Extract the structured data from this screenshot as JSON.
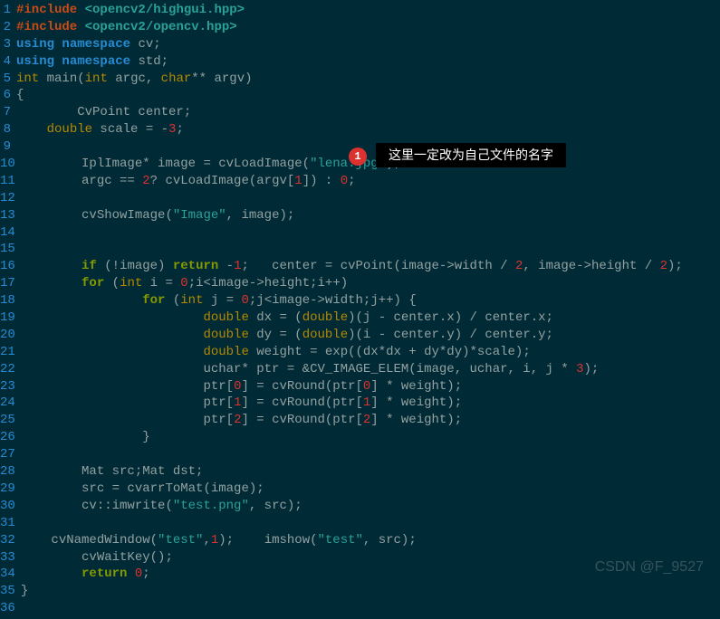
{
  "annotation": {
    "badge": "1",
    "text": "这里一定改为自己文件的名字"
  },
  "watermark": "CSDN @F_9527",
  "lines": [
    {
      "n": 1,
      "tokens": [
        [
          "preproc",
          "#include "
        ],
        [
          "incpath",
          "<opencv2/highgui.hpp>"
        ]
      ]
    },
    {
      "n": 2,
      "tokens": [
        [
          "preproc",
          "#include "
        ],
        [
          "incpath",
          "<opencv2/opencv.hpp>"
        ]
      ]
    },
    {
      "n": 3,
      "tokens": [
        [
          "kwblue",
          "using"
        ],
        [
          "ident",
          " "
        ],
        [
          "kwblue",
          "namespace"
        ],
        [
          "ident",
          " cv;"
        ]
      ]
    },
    {
      "n": 4,
      "tokens": [
        [
          "kwblue",
          "using"
        ],
        [
          "ident",
          " "
        ],
        [
          "kwblue",
          "namespace"
        ],
        [
          "ident",
          " std;"
        ]
      ]
    },
    {
      "n": 5,
      "tokens": [
        [
          "type",
          "int"
        ],
        [
          "ident",
          " main("
        ],
        [
          "type",
          "int"
        ],
        [
          "ident",
          " argc, "
        ],
        [
          "type",
          "char"
        ],
        [
          "ident",
          "** argv)"
        ]
      ]
    },
    {
      "n": 6,
      "tokens": [
        [
          "punc",
          "{"
        ]
      ]
    },
    {
      "n": 7,
      "tokens": [
        [
          "ident",
          "        CvPoint center;"
        ]
      ]
    },
    {
      "n": 8,
      "tokens": [
        [
          "ident",
          "    "
        ],
        [
          "type",
          "double"
        ],
        [
          "ident",
          " scale = -"
        ],
        [
          "num",
          "3"
        ],
        [
          "ident",
          ";"
        ]
      ]
    },
    {
      "n": 9,
      "tokens": [
        [
          "ident",
          " "
        ]
      ]
    },
    {
      "n": 10,
      "tokens": [
        [
          "ident",
          "        IplImage* image = cvLoadImage("
        ],
        [
          "str",
          "\"lena.jpg\""
        ],
        [
          "ident",
          ");"
        ]
      ]
    },
    {
      "n": 11,
      "tokens": [
        [
          "ident",
          "        argc == "
        ],
        [
          "num",
          "2"
        ],
        [
          "ident",
          "? cvLoadImage(argv["
        ],
        [
          "num",
          "1"
        ],
        [
          "ident",
          "]) : "
        ],
        [
          "num",
          "0"
        ],
        [
          "ident",
          ";"
        ]
      ]
    },
    {
      "n": 12,
      "tokens": [
        [
          "ident",
          " "
        ]
      ]
    },
    {
      "n": 13,
      "tokens": [
        [
          "ident",
          "        cvShowImage("
        ],
        [
          "str",
          "\"Image\""
        ],
        [
          "ident",
          ", image);"
        ]
      ]
    },
    {
      "n": 14,
      "tokens": [
        [
          "ident",
          " "
        ]
      ]
    },
    {
      "n": 15,
      "tokens": [
        [
          "ident",
          " "
        ]
      ]
    },
    {
      "n": 16,
      "tokens": [
        [
          "ident",
          "        "
        ],
        [
          "kw",
          "if"
        ],
        [
          "ident",
          " (!image) "
        ],
        [
          "kw",
          "return"
        ],
        [
          "ident",
          " -"
        ],
        [
          "num",
          "1"
        ],
        [
          "ident",
          ";   center = cvPoint(image->width / "
        ],
        [
          "num",
          "2"
        ],
        [
          "ident",
          ", image->height / "
        ],
        [
          "num",
          "2"
        ],
        [
          "ident",
          ");"
        ]
      ]
    },
    {
      "n": 17,
      "tokens": [
        [
          "ident",
          "        "
        ],
        [
          "kw",
          "for"
        ],
        [
          "ident",
          " ("
        ],
        [
          "type",
          "int"
        ],
        [
          "ident",
          " i = "
        ],
        [
          "num",
          "0"
        ],
        [
          "ident",
          ";i<image->height;i++)"
        ]
      ]
    },
    {
      "n": 18,
      "tokens": [
        [
          "ident",
          "                "
        ],
        [
          "kw",
          "for"
        ],
        [
          "ident",
          " ("
        ],
        [
          "type",
          "int"
        ],
        [
          "ident",
          " j = "
        ],
        [
          "num",
          "0"
        ],
        [
          "ident",
          ";j<image->width;j++) {"
        ]
      ]
    },
    {
      "n": 19,
      "tokens": [
        [
          "ident",
          "                        "
        ],
        [
          "type",
          "double"
        ],
        [
          "ident",
          " dx = ("
        ],
        [
          "type",
          "double"
        ],
        [
          "ident",
          ")(j - center.x) / center.x;"
        ]
      ]
    },
    {
      "n": 20,
      "tokens": [
        [
          "ident",
          "                        "
        ],
        [
          "type",
          "double"
        ],
        [
          "ident",
          " dy = ("
        ],
        [
          "type",
          "double"
        ],
        [
          "ident",
          ")(i - center.y) / center.y;"
        ]
      ]
    },
    {
      "n": 21,
      "tokens": [
        [
          "ident",
          "                        "
        ],
        [
          "type",
          "double"
        ],
        [
          "ident",
          " weight = exp((dx*dx + dy*dy)*scale);"
        ]
      ]
    },
    {
      "n": 22,
      "tokens": [
        [
          "ident",
          "                        uchar* ptr = &CV_IMAGE_ELEM(image, uchar, i, j * "
        ],
        [
          "num",
          "3"
        ],
        [
          "ident",
          ");"
        ]
      ]
    },
    {
      "n": 23,
      "tokens": [
        [
          "ident",
          "                        ptr["
        ],
        [
          "num",
          "0"
        ],
        [
          "ident",
          "] = cvRound(ptr["
        ],
        [
          "num",
          "0"
        ],
        [
          "ident",
          "] * weight);"
        ]
      ]
    },
    {
      "n": 24,
      "tokens": [
        [
          "ident",
          "                        ptr["
        ],
        [
          "num",
          "1"
        ],
        [
          "ident",
          "] = cvRound(ptr["
        ],
        [
          "num",
          "1"
        ],
        [
          "ident",
          "] * weight);"
        ]
      ]
    },
    {
      "n": 25,
      "tokens": [
        [
          "ident",
          "                        ptr["
        ],
        [
          "num",
          "2"
        ],
        [
          "ident",
          "] = cvRound(ptr["
        ],
        [
          "num",
          "2"
        ],
        [
          "ident",
          "] * weight);"
        ]
      ]
    },
    {
      "n": 26,
      "tokens": [
        [
          "ident",
          "                }"
        ]
      ]
    },
    {
      "n": 27,
      "tokens": [
        [
          "ident",
          " "
        ]
      ]
    },
    {
      "n": 28,
      "tokens": [
        [
          "ident",
          "        Mat src;Mat dst;"
        ]
      ]
    },
    {
      "n": 29,
      "tokens": [
        [
          "ident",
          "        src = cvarrToMat(image);"
        ]
      ]
    },
    {
      "n": 30,
      "tokens": [
        [
          "ident",
          "        cv::imwrite("
        ],
        [
          "str",
          "\"test.png\""
        ],
        [
          "ident",
          ", src);"
        ]
      ]
    },
    {
      "n": 31,
      "tokens": [
        [
          "ident",
          " "
        ]
      ]
    },
    {
      "n": 32,
      "tokens": [
        [
          "ident",
          "    cvNamedWindow("
        ],
        [
          "str",
          "\"test\""
        ],
        [
          "ident",
          ","
        ],
        [
          "num",
          "1"
        ],
        [
          "ident",
          ");    imshow("
        ],
        [
          "str",
          "\"test\""
        ],
        [
          "ident",
          ", src);"
        ]
      ]
    },
    {
      "n": 33,
      "tokens": [
        [
          "ident",
          "        cvWaitKey();"
        ]
      ]
    },
    {
      "n": 34,
      "tokens": [
        [
          "ident",
          "        "
        ],
        [
          "kw",
          "return"
        ],
        [
          "ident",
          " "
        ],
        [
          "num",
          "0"
        ],
        [
          "ident",
          ";"
        ]
      ]
    },
    {
      "n": 35,
      "tokens": [
        [
          "punc",
          "}"
        ]
      ]
    },
    {
      "n": 36,
      "tokens": [
        [
          "ident",
          " "
        ]
      ]
    }
  ]
}
